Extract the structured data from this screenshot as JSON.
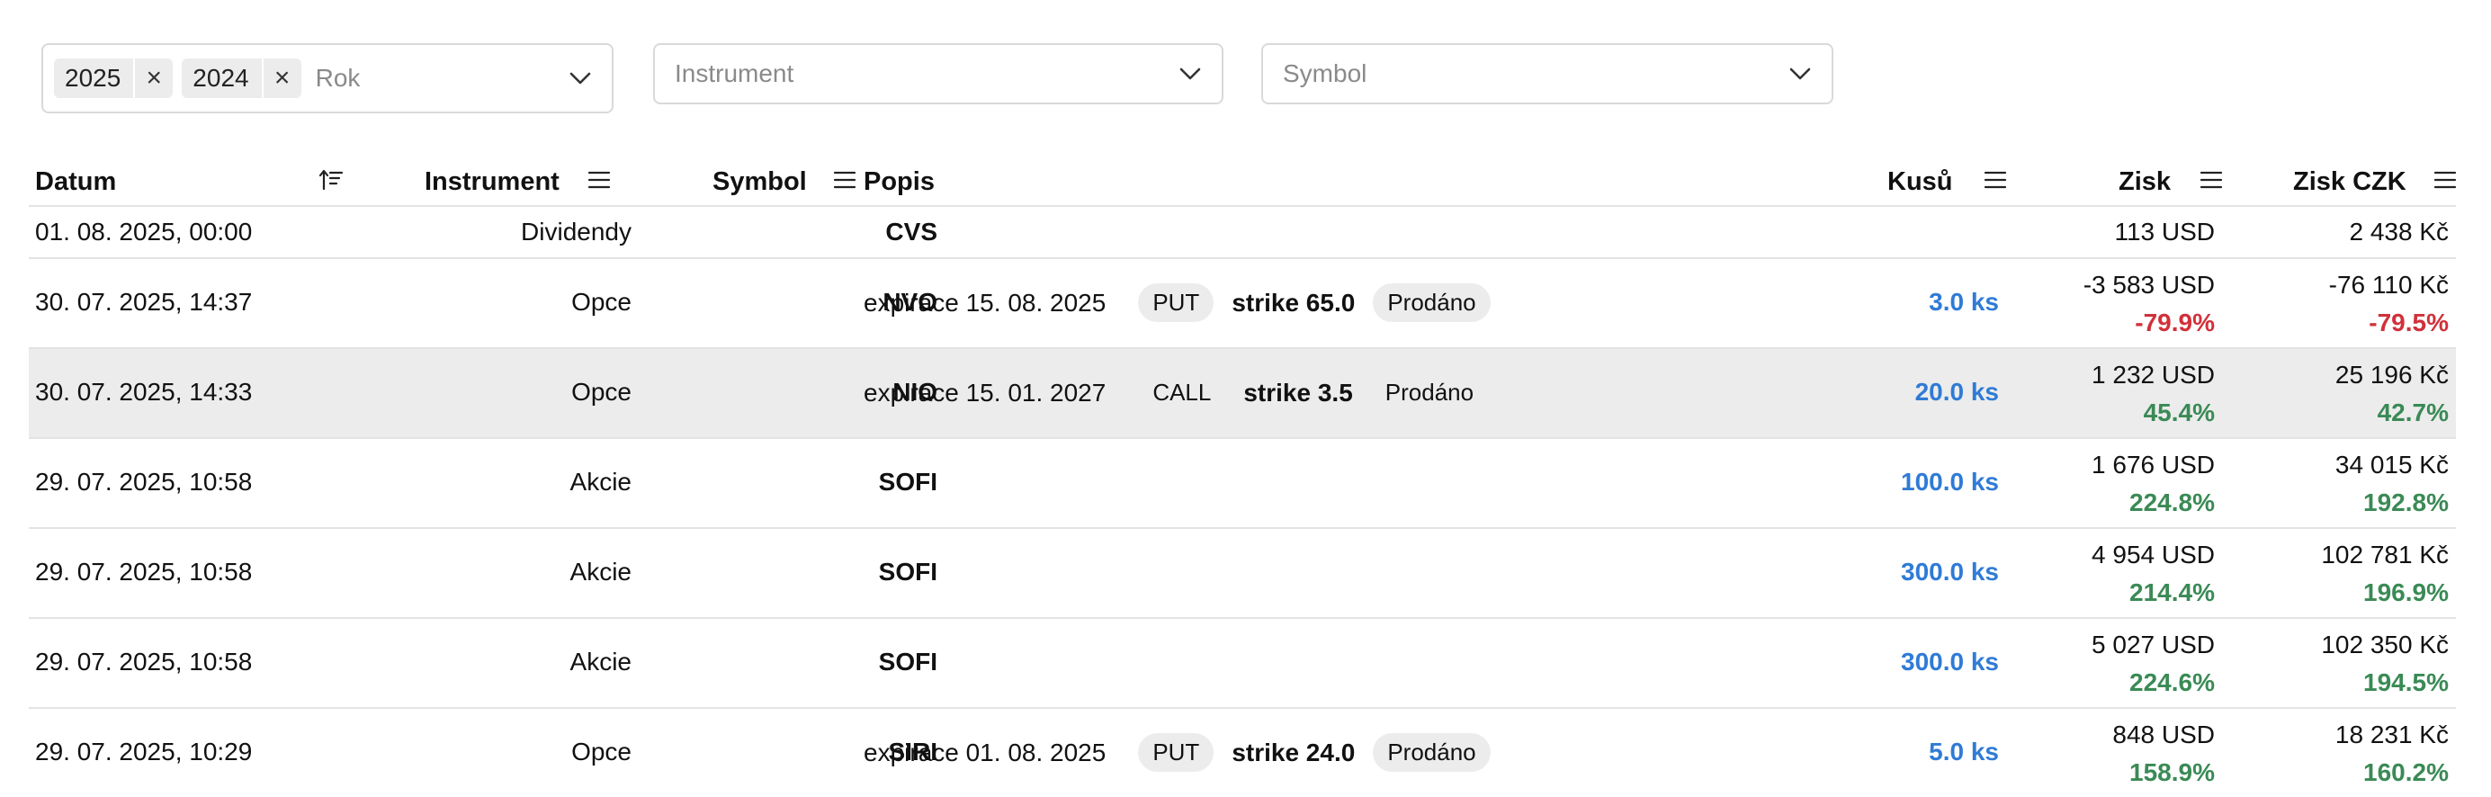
{
  "filters": {
    "year": {
      "chips": [
        "2025",
        "2024"
      ],
      "placeholder": "Rok"
    },
    "instrument": {
      "placeholder": "Instrument"
    },
    "symbol": {
      "placeholder": "Symbol"
    }
  },
  "table": {
    "headers": {
      "datum": "Datum",
      "instrument": "Instrument",
      "symbol": "Symbol",
      "popis": "Popis",
      "kusu": "Kusů",
      "zisk": "Zisk",
      "zisk_czk": "Zisk CZK"
    },
    "rows": [
      {
        "datum": "01. 08. 2025, 00:00",
        "instrument": "Dividendy",
        "symbol": "CVS",
        "kusu": "",
        "zisk": "113 USD",
        "zisk_pct": "",
        "zisk_czk": "2 438 Kč",
        "zisk_czk_pct": ""
      },
      {
        "datum": "30. 07. 2025, 14:37",
        "instrument": "Opce",
        "symbol": "NVO",
        "expirace": "expirace 15. 08. 2025",
        "typ": "PUT",
        "strike": "strike 65.0",
        "stav": "Prodáno",
        "kusu": "3.0 ks",
        "zisk": "-3 583 USD",
        "zisk_pct": "-79.9%",
        "zisk_czk": "-76 110 Kč",
        "zisk_czk_pct": "-79.5%"
      },
      {
        "datum": "30. 07. 2025, 14:33",
        "instrument": "Opce",
        "symbol": "NIO",
        "expirace": "expirace 15. 01. 2027",
        "typ": "CALL",
        "strike": "strike 3.5",
        "stav": "Prodáno",
        "kusu": "20.0 ks",
        "zisk": "1 232 USD",
        "zisk_pct": "45.4%",
        "zisk_czk": "25 196 Kč",
        "zisk_czk_pct": "42.7%"
      },
      {
        "datum": "29. 07. 2025, 10:58",
        "instrument": "Akcie",
        "symbol": "SOFI",
        "kusu": "100.0 ks",
        "zisk": "1 676 USD",
        "zisk_pct": "224.8%",
        "zisk_czk": "34 015 Kč",
        "zisk_czk_pct": "192.8%"
      },
      {
        "datum": "29. 07. 2025, 10:58",
        "instrument": "Akcie",
        "symbol": "SOFI",
        "kusu": "300.0 ks",
        "zisk": "4 954 USD",
        "zisk_pct": "214.4%",
        "zisk_czk": "102 781 Kč",
        "zisk_czk_pct": "196.9%"
      },
      {
        "datum": "29. 07. 2025, 10:58",
        "instrument": "Akcie",
        "symbol": "SOFI",
        "kusu": "300.0 ks",
        "zisk": "5 027 USD",
        "zisk_pct": "224.6%",
        "zisk_czk": "102 350 Kč",
        "zisk_czk_pct": "194.5%"
      },
      {
        "datum": "29. 07. 2025, 10:29",
        "instrument": "Opce",
        "symbol": "SIRI",
        "expirace": "expirace 01. 08. 2025",
        "typ": "PUT",
        "strike": "strike 24.0",
        "stav": "Prodáno",
        "kusu": "5.0 ks",
        "zisk": "848 USD",
        "zisk_pct": "158.9%",
        "zisk_czk": "18 231 Kč",
        "zisk_czk_pct": "160.2%"
      }
    ]
  },
  "colors": {
    "positive": "#3a8a55",
    "negative": "#d0313a",
    "quantity": "#2f7bd6",
    "highlight_row": "#ececec"
  },
  "icons": [
    "close-icon",
    "chevron-down-icon",
    "sort-ascending-icon",
    "menu-icon"
  ]
}
